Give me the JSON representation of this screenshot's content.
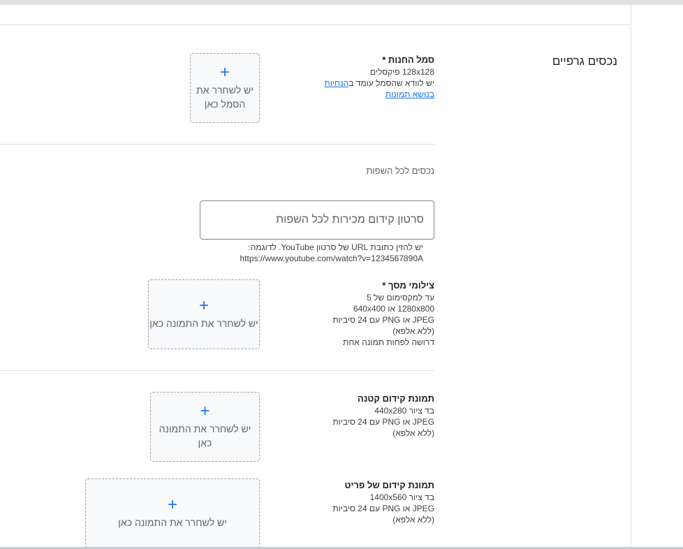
{
  "section": {
    "title": "נכסים גרפיים"
  },
  "store_icon": {
    "label": "סמל החנות *",
    "size": "128x128 פיקסלים",
    "desc_prefix": "יש לוודא שהסמל עומד ב",
    "link1": "הנחיות",
    "link2": "בנושא תמונות",
    "upload_line1": "יש לשחרר את",
    "upload_line2": "הסמל כאן"
  },
  "all_languages": {
    "heading": "נכסים לכל השפות"
  },
  "promo_video": {
    "placeholder": "סרטון קידום מכירות לכל השפות",
    "hint_line1": "יש להזין כתובת URL של סרטון YouTube. לדוגמה:",
    "hint_line2": "https://www.youtube.com/watch?v=1234567890A"
  },
  "screenshots": {
    "label": "צילומי מסך *",
    "line1": "עד למקסימום של 5",
    "line2": "1280x800 או 640x400",
    "line3": "JPEG או PNG עם 24 סיביות (ללא אלפא)",
    "line4": "דרושה לפחות תמונה אחת",
    "upload_text": "יש לשחרר את התמונה כאן"
  },
  "small_promo": {
    "label": "תמונת קידום קטנה",
    "line1": "בד ציור 440x280",
    "line2": "JPEG או PNG עם 24 סיביות (ללא אלפא)",
    "upload_text": "יש לשחרר את התמונה כאן"
  },
  "marquee_promo": {
    "label": "תמונת קידום של פריט",
    "line1": "בד ציור 1400x560",
    "line2": "JPEG או PNG עם 24 סיביות (ללא אלפא)",
    "upload_text": "יש לשחרר את התמונה כאן"
  },
  "icons": {
    "upload": "plus-icon"
  },
  "colors": {
    "accent": "#1a73e8",
    "border": "#9aa0a6",
    "upload_bg": "#f8f9fa"
  }
}
